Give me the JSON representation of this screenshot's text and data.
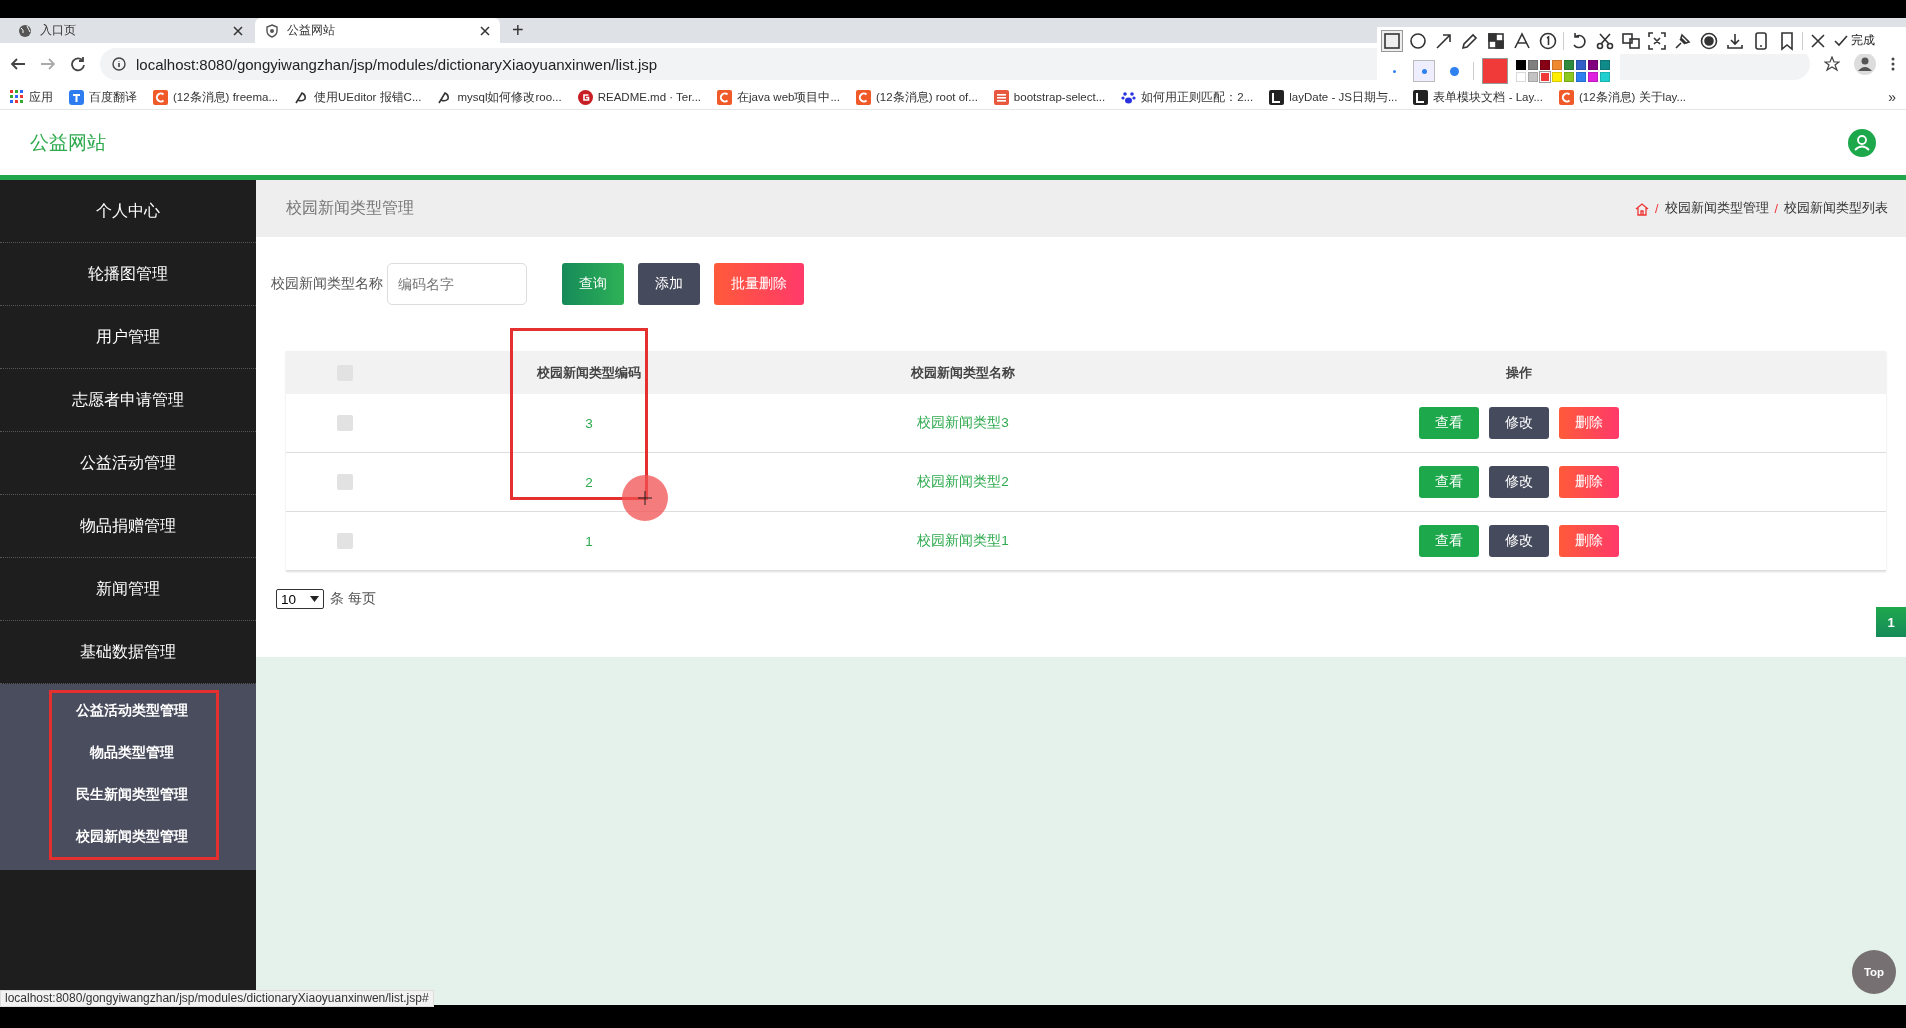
{
  "browser": {
    "tabs": [
      {
        "title": "入口页",
        "kind": "globe",
        "selected": false
      },
      {
        "title": "公益网站",
        "kind": "shield",
        "selected": true
      }
    ],
    "new_tab": "+",
    "address": "localhost:8080/gongyiwangzhan/jsp/modules/dictionaryXiaoyuanxinwen/list.jsp",
    "bookmarks": [
      {
        "label": "应用",
        "kind": "apps"
      },
      {
        "label": "百度翻译",
        "kind": "translate"
      },
      {
        "label": "(12条消息) freema...",
        "kind": "csdn"
      },
      {
        "label": "使用UEditor 报错C...",
        "kind": "feather"
      },
      {
        "label": "mysql如何修改roo...",
        "kind": "feather"
      },
      {
        "label": "README.md · Ter...",
        "kind": "gitee"
      },
      {
        "label": "在java web项目中...",
        "kind": "csdn"
      },
      {
        "label": "(12条消息) root of...",
        "kind": "csdn"
      },
      {
        "label": "bootstrap-select...",
        "kind": "jian"
      },
      {
        "label": "如何用正则匹配：2...",
        "kind": "paw"
      },
      {
        "label": "layDate - JS日期与...",
        "kind": "lay"
      },
      {
        "label": "表单模块文档 - Lay...",
        "kind": "lay"
      },
      {
        "label": "(12条消息) 关于lay...",
        "kind": "csdn"
      }
    ],
    "more_bookmarks": "»"
  },
  "capture_toolbar": {
    "tools": [
      {
        "kind": "rect",
        "selected": true
      },
      {
        "kind": "circle",
        "selected": false
      },
      {
        "kind": "arrow",
        "selected": false
      },
      {
        "kind": "pencil",
        "selected": false
      },
      {
        "kind": "mosaic",
        "selected": false
      },
      {
        "kind": "text",
        "selected": false
      },
      {
        "kind": "number",
        "selected": false
      },
      {
        "kind": "undo",
        "selected": false
      },
      {
        "kind": "scissors",
        "selected": false
      },
      {
        "kind": "translate",
        "selected": false
      },
      {
        "kind": "capture",
        "selected": false
      },
      {
        "kind": "pin",
        "selected": false
      },
      {
        "kind": "record",
        "selected": false
      },
      {
        "kind": "download",
        "selected": false
      },
      {
        "kind": "phone",
        "selected": false
      },
      {
        "kind": "bookmark",
        "selected": false
      },
      {
        "kind": "close",
        "selected": false
      }
    ],
    "done": "完成",
    "sizes": [
      {
        "kind": "small",
        "selected": false
      },
      {
        "kind": "medium",
        "selected": true
      },
      {
        "kind": "large",
        "selected": false
      }
    ],
    "palette": [
      {
        "color": "#000000",
        "selected": false
      },
      {
        "color": "#7f7f7f",
        "selected": false
      },
      {
        "color": "#880015",
        "selected": false
      },
      {
        "color": "#f08a30",
        "selected": false
      },
      {
        "color": "#2e8b3e",
        "selected": false
      },
      {
        "color": "#3060c8",
        "selected": false
      },
      {
        "color": "#800080",
        "selected": false
      },
      {
        "color": "#108a8a",
        "selected": false
      },
      {
        "color": "#ffffff",
        "selected": false
      },
      {
        "color": "#c3c3c3",
        "selected": false
      },
      {
        "color": "#f03a3a",
        "selected": true
      },
      {
        "color": "#ffee00",
        "selected": false
      },
      {
        "color": "#8cc81e",
        "selected": false
      },
      {
        "color": "#2f80f0",
        "selected": false
      },
      {
        "color": "#e020e0",
        "selected": false
      },
      {
        "color": "#20d0d0",
        "selected": false
      }
    ]
  },
  "site": {
    "title": "公益网站"
  },
  "sidebar": {
    "items": [
      {
        "label": "个人中心"
      },
      {
        "label": "轮播图管理"
      },
      {
        "label": "用户管理"
      },
      {
        "label": "志愿者申请管理"
      },
      {
        "label": "公益活动管理"
      },
      {
        "label": "物品捐赠管理"
      },
      {
        "label": "新闻管理"
      },
      {
        "label": "基础数据管理",
        "children": [
          {
            "label": "公益活动类型管理"
          },
          {
            "label": "物品类型管理"
          },
          {
            "label": "民生新闻类型管理"
          },
          {
            "label": "校园新闻类型管理"
          }
        ]
      }
    ]
  },
  "content": {
    "title": "校园新闻类型管理",
    "breadcrumb": [
      {
        "separator": "/",
        "label": "校园新闻类型管理"
      },
      {
        "separator": "/",
        "label": "校园新闻类型列表"
      }
    ],
    "search": {
      "label": "校园新闻类型名称",
      "placeholder": "编码名字"
    },
    "buttons": [
      {
        "label": "查询",
        "kind": "search"
      },
      {
        "label": "添加",
        "kind": "add"
      },
      {
        "label": "批量删除",
        "kind": "delete"
      }
    ],
    "table": {
      "header_checked": false,
      "columns": [
        "校园新闻类型编码",
        "校园新闻类型名称",
        "操作"
      ],
      "rows": [
        {
          "checked": false,
          "code": "3",
          "name": "校园新闻类型3",
          "actions": [
            {
              "label": "查看",
              "kind": "view"
            },
            {
              "label": "修改",
              "kind": "edit"
            },
            {
              "label": "删除",
              "kind": "delete"
            }
          ]
        },
        {
          "checked": false,
          "code": "2",
          "name": "校园新闻类型2",
          "actions": [
            {
              "label": "查看",
              "kind": "view"
            },
            {
              "label": "修改",
              "kind": "edit"
            },
            {
              "label": "删除",
              "kind": "delete"
            }
          ]
        },
        {
          "checked": false,
          "code": "1",
          "name": "校园新闻类型1",
          "actions": [
            {
              "label": "查看",
              "kind": "view"
            },
            {
              "label": "修改",
              "kind": "edit"
            },
            {
              "label": "删除",
              "kind": "delete"
            }
          ]
        }
      ]
    },
    "page_size": "10",
    "page_size_label": "条 每页",
    "pages": [
      {
        "label": "1",
        "selected": true
      }
    ]
  },
  "top_button": "Top",
  "status_url": "localhost:8080/gongyiwangzhan/jsp/modules/dictionaryXiaoyuanxinwen/list.jsp#"
}
